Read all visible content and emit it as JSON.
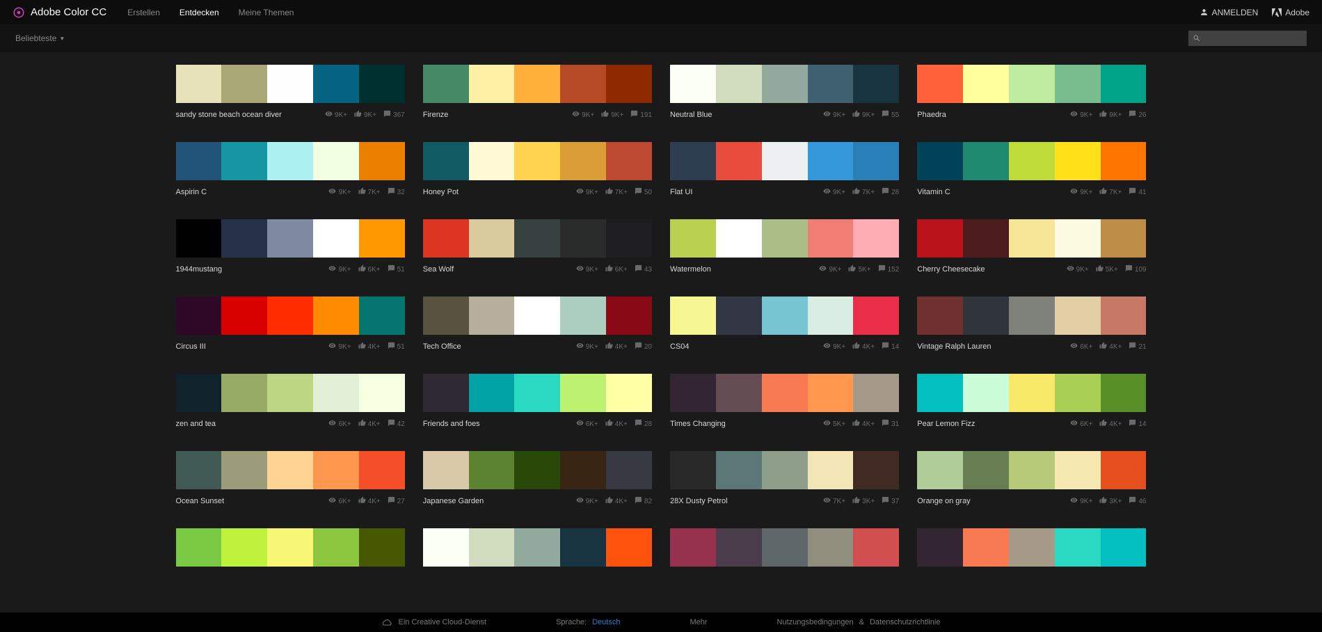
{
  "brand": "Adobe Color CC",
  "nav": {
    "erstellen": "Erstellen",
    "entdecken": "Entdecken",
    "meine": "Meine Themen"
  },
  "auth": {
    "login": "ANMELDEN",
    "adobe": "Adobe"
  },
  "filter": "Beliebteste",
  "search_placeholder": "",
  "footer": {
    "service": "Ein Creative Cloud-Dienst",
    "sprache_label": "Sprache:",
    "sprache": "Deutsch",
    "mehr": "Mehr",
    "terms": "Nutzungsbedingungen",
    "amp": "&",
    "privacy": "Datenschutzrichtlinie"
  },
  "themes": [
    {
      "name": "sandy stone beach ocean diver",
      "views": "9K+",
      "likes": "9K+",
      "comments": "367",
      "c": [
        "#e8e2bb",
        "#a9a977",
        "#fefefe",
        "#046380",
        "#002f2f"
      ]
    },
    {
      "name": "Firenze",
      "views": "9K+",
      "likes": "9K+",
      "comments": "191",
      "c": [
        "#468966",
        "#fff0a5",
        "#ffb03b",
        "#b64926",
        "#8e2800"
      ]
    },
    {
      "name": "Neutral Blue",
      "views": "9K+",
      "likes": "9K+",
      "comments": "55",
      "c": [
        "#fcfff5",
        "#d1dbbd",
        "#91aa9d",
        "#3e606f",
        "#193441"
      ]
    },
    {
      "name": "Phaedra",
      "views": "9K+",
      "likes": "9K+",
      "comments": "26",
      "c": [
        "#ff6138",
        "#ffff9d",
        "#beeb9f",
        "#79bd8f",
        "#00a388"
      ]
    },
    {
      "name": "Aspirin C",
      "views": "9K+",
      "likes": "7K+",
      "comments": "32",
      "c": [
        "#225378",
        "#1695a3",
        "#acf0f2",
        "#f3ffe2",
        "#eb7f00"
      ]
    },
    {
      "name": "Honey Pot",
      "views": "9K+",
      "likes": "7K+",
      "comments": "50",
      "c": [
        "#105b63",
        "#fffad5",
        "#ffd34e",
        "#db9e36",
        "#bd4932"
      ]
    },
    {
      "name": "Flat UI",
      "views": "9K+",
      "likes": "7K+",
      "comments": "28",
      "c": [
        "#2c3e50",
        "#e74c3c",
        "#ecf0f1",
        "#3498db",
        "#2980b9"
      ]
    },
    {
      "name": "Vitamin C",
      "views": "9K+",
      "likes": "7K+",
      "comments": "41",
      "c": [
        "#004358",
        "#1f8a70",
        "#bedb39",
        "#ffe11a",
        "#fd7400"
      ]
    },
    {
      "name": "1944mustang",
      "views": "9K+",
      "likes": "6K+",
      "comments": "51",
      "c": [
        "#000000",
        "#263248",
        "#7e8aa2",
        "#ffffff",
        "#ff9800"
      ]
    },
    {
      "name": "Sea Wolf",
      "views": "9K+",
      "likes": "6K+",
      "comments": "43",
      "c": [
        "#dc3522",
        "#d9cb9e",
        "#374140",
        "#2a2c2b",
        "#1e1e20"
      ]
    },
    {
      "name": "Watermelon",
      "views": "9K+",
      "likes": "5K+",
      "comments": "152",
      "c": [
        "#b9d050",
        "#ffffff",
        "#acbe88",
        "#f07e74",
        "#ffadb3"
      ]
    },
    {
      "name": "Cherry Cheesecake",
      "views": "9K+",
      "likes": "5K+",
      "comments": "109",
      "c": [
        "#b9121b",
        "#4c1b1b",
        "#f6e497",
        "#fcfae1",
        "#bd8d46"
      ]
    },
    {
      "name": "Circus III",
      "views": "9K+",
      "likes": "4K+",
      "comments": "51",
      "c": [
        "#2e0927",
        "#d90000",
        "#ff2d00",
        "#ff8c00",
        "#04756f"
      ]
    },
    {
      "name": "Tech Office",
      "views": "9K+",
      "likes": "4K+",
      "comments": "20",
      "c": [
        "#595241",
        "#b8ae9c",
        "#ffffff",
        "#accec0",
        "#8a0917"
      ]
    },
    {
      "name": "CS04",
      "views": "9K+",
      "likes": "4K+",
      "comments": "14",
      "c": [
        "#f6f792",
        "#333745",
        "#77c4d3",
        "#daede2",
        "#ea2e49"
      ]
    },
    {
      "name": "Vintage Ralph Lauren",
      "views": "6K+",
      "likes": "4K+",
      "comments": "21",
      "c": [
        "#703030",
        "#2f343b",
        "#7e827a",
        "#e3cda4",
        "#c77966"
      ]
    },
    {
      "name": "zen and tea",
      "views": "6K+",
      "likes": "4K+",
      "comments": "42",
      "c": [
        "#10222b",
        "#95ab63",
        "#bdd684",
        "#e2f0d6",
        "#f6ffe0"
      ]
    },
    {
      "name": "Friends and foes",
      "views": "6K+",
      "likes": "4K+",
      "comments": "28",
      "c": [
        "#2f2933",
        "#01a2a6",
        "#29d9c2",
        "#bdf271",
        "#ffffa6"
      ]
    },
    {
      "name": "Times Changing",
      "views": "5K+",
      "likes": "4K+",
      "comments": "31",
      "c": [
        "#332532",
        "#644d52",
        "#f77a52",
        "#ff974f",
        "#a49a87"
      ]
    },
    {
      "name": "Pear Lemon Fizz",
      "views": "6K+",
      "likes": "4K+",
      "comments": "14",
      "c": [
        "#04bfbf",
        "#cafcd8",
        "#f7e967",
        "#a9cf54",
        "#588f27"
      ]
    },
    {
      "name": "Ocean Sunset",
      "views": "6K+",
      "likes": "4K+",
      "comments": "27",
      "c": [
        "#405952",
        "#9c9b7a",
        "#ffd393",
        "#ff974f",
        "#f54f29"
      ]
    },
    {
      "name": "Japanese Garden",
      "views": "9K+",
      "likes": "4K+",
      "comments": "82",
      "c": [
        "#d8caa8",
        "#5c832f",
        "#284907",
        "#382513",
        "#363942"
      ]
    },
    {
      "name": "28X Dusty Petrol",
      "views": "7K+",
      "likes": "3K+",
      "comments": "37",
      "c": [
        "#292929",
        "#5b7876",
        "#8f9e8b",
        "#f2e6b6",
        "#412a22"
      ]
    },
    {
      "name": "Orange on gray",
      "views": "9K+",
      "likes": "3K+",
      "comments": "46",
      "c": [
        "#b0cc99",
        "#677e52",
        "#b7ca79",
        "#f6e8b1",
        "#e6501e"
      ]
    },
    {
      "name": "",
      "views": "",
      "likes": "",
      "comments": "",
      "c": [
        "#7ac943",
        "#bff23c",
        "#f7f775",
        "#8cc63f",
        "#465902"
      ]
    },
    {
      "name": "",
      "views": "",
      "likes": "",
      "comments": "",
      "c": [
        "#fcfff5",
        "#d1dbbd",
        "#91aa9d",
        "#193441",
        "#ff530d"
      ]
    },
    {
      "name": "",
      "views": "",
      "likes": "",
      "comments": "",
      "c": [
        "#96324e",
        "#4a3c4b",
        "#60676a",
        "#928e7e",
        "#d14f4f"
      ]
    },
    {
      "name": "",
      "views": "",
      "likes": "",
      "comments": "",
      "c": [
        "#332532",
        "#f77a52",
        "#a49a87",
        "#29d9c2",
        "#04bfbf"
      ]
    }
  ]
}
